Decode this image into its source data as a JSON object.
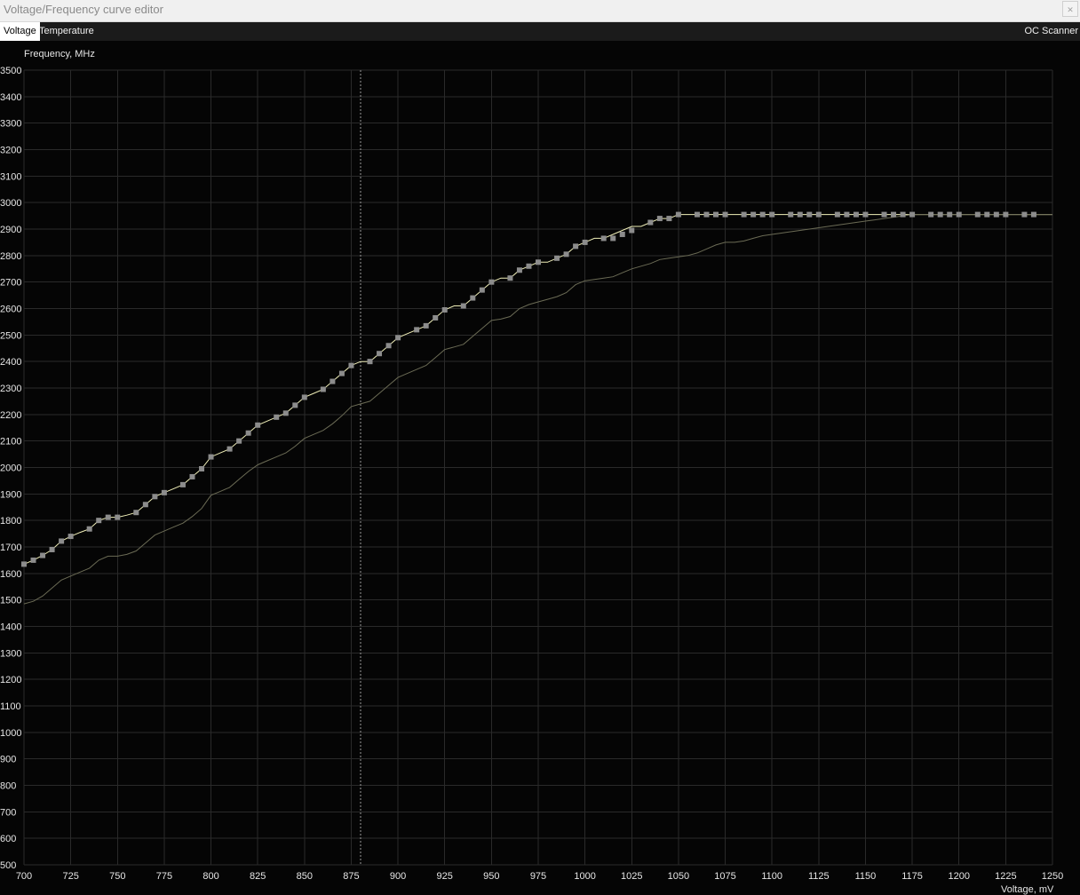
{
  "window": {
    "title": "Voltage/Frequency curve editor",
    "close_icon": "close-icon"
  },
  "tabs": [
    {
      "label": "Voltage",
      "active": true
    },
    {
      "label": "Temperature",
      "active": false
    }
  ],
  "toolbar": {
    "oc_scanner_label": "OC Scanner"
  },
  "colors": {
    "background": "#050505",
    "grid": "#2a2a2a",
    "curve": "#f0efb8",
    "point": "#8c8c8c",
    "baseline": "#6b6b55",
    "cursor": "#9a9a9a"
  },
  "chart_data": {
    "type": "line",
    "ylabel": "Frequency, MHz",
    "xlabel": "Voltage, mV",
    "xlim": [
      700,
      1250
    ],
    "ylim": [
      500,
      3500
    ],
    "x_ticks": [
      700,
      725,
      750,
      775,
      800,
      825,
      850,
      875,
      900,
      925,
      950,
      975,
      1000,
      1025,
      1050,
      1075,
      1100,
      1125,
      1150,
      1175,
      1200,
      1225,
      1250
    ],
    "y_ticks": [
      500,
      600,
      700,
      800,
      900,
      1000,
      1100,
      1200,
      1300,
      1400,
      1500,
      1600,
      1700,
      1800,
      1900,
      2000,
      2100,
      2200,
      2300,
      2400,
      2500,
      2600,
      2700,
      2800,
      2900,
      3000,
      3100,
      3200,
      3300,
      3400,
      3500
    ],
    "grid": true,
    "cursor_voltage": 880,
    "series": [
      {
        "role": "curve",
        "x": [
          700,
          705,
          710,
          715,
          720,
          725,
          730,
          735,
          740,
          745,
          750,
          755,
          760,
          765,
          770,
          775,
          780,
          785,
          790,
          795,
          800,
          805,
          810,
          815,
          820,
          825,
          830,
          835,
          840,
          845,
          850,
          855,
          860,
          865,
          870,
          875,
          880,
          885,
          890,
          895,
          900,
          905,
          910,
          915,
          920,
          925,
          930,
          935,
          940,
          945,
          950,
          955,
          960,
          965,
          970,
          975,
          980,
          985,
          990,
          995,
          1000,
          1005,
          1010,
          1015,
          1020,
          1025,
          1030,
          1035,
          1040,
          1045,
          1050,
          1055,
          1060,
          1065,
          1070,
          1075,
          1080,
          1085,
          1090,
          1095,
          1100,
          1105,
          1110,
          1115,
          1120,
          1125,
          1130,
          1135,
          1140,
          1145,
          1150,
          1155,
          1160,
          1165,
          1170,
          1175,
          1180,
          1185,
          1190,
          1195,
          1200,
          1205,
          1210,
          1215,
          1220,
          1225,
          1230,
          1235,
          1240,
          1245,
          1250
        ],
        "y": [
          1635,
          1650,
          1668,
          1690,
          1722,
          1740,
          1755,
          1768,
          1800,
          1812,
          1812,
          1820,
          1830,
          1860,
          1890,
          1905,
          1920,
          1935,
          1965,
          1995,
          2040,
          2055,
          2070,
          2100,
          2130,
          2160,
          2175,
          2190,
          2205,
          2235,
          2265,
          2280,
          2295,
          2325,
          2355,
          2385,
          2400,
          2400,
          2430,
          2460,
          2490,
          2505,
          2520,
          2535,
          2565,
          2595,
          2610,
          2610,
          2640,
          2670,
          2700,
          2715,
          2715,
          2745,
          2760,
          2775,
          2775,
          2790,
          2805,
          2835,
          2850,
          2865,
          2865,
          2880,
          2895,
          2910,
          2910,
          2925,
          2940,
          2940,
          2955,
          2955,
          2955,
          2955,
          2955,
          2955,
          2955,
          2955,
          2955,
          2955,
          2955,
          2955,
          2955,
          2955,
          2955,
          2955,
          2955,
          2955,
          2955,
          2955,
          2955,
          2955,
          2955,
          2955,
          2955,
          2955,
          2955,
          2955,
          2955,
          2955,
          2955,
          2955,
          2955,
          2955,
          2955,
          2955,
          2955,
          2955,
          2955,
          2955,
          2955
        ]
      },
      {
        "role": "baseline",
        "x": [
          700,
          705,
          710,
          715,
          720,
          725,
          730,
          735,
          740,
          745,
          750,
          755,
          760,
          765,
          770,
          775,
          780,
          785,
          790,
          795,
          800,
          805,
          810,
          815,
          820,
          825,
          830,
          835,
          840,
          845,
          850,
          855,
          860,
          865,
          870,
          875,
          880,
          885,
          890,
          895,
          900,
          905,
          910,
          915,
          920,
          925,
          930,
          935,
          940,
          945,
          950,
          955,
          960,
          965,
          970,
          975,
          980,
          985,
          990,
          995,
          1000,
          1005,
          1010,
          1015,
          1020,
          1025,
          1030,
          1035,
          1040,
          1045,
          1050,
          1055,
          1060,
          1065,
          1070,
          1075,
          1080,
          1085,
          1090,
          1095,
          1100,
          1105,
          1110,
          1115,
          1120,
          1125,
          1130,
          1135,
          1140,
          1145,
          1150,
          1155,
          1160,
          1165,
          1170,
          1175,
          1180,
          1185,
          1190,
          1195,
          1200,
          1205,
          1210,
          1215,
          1220,
          1225,
          1230,
          1235,
          1240,
          1245,
          1250
        ],
        "y": [
          1485,
          1495,
          1515,
          1545,
          1575,
          1590,
          1605,
          1620,
          1650,
          1665,
          1665,
          1672,
          1685,
          1715,
          1745,
          1760,
          1775,
          1790,
          1815,
          1845,
          1895,
          1910,
          1925,
          1955,
          1985,
          2010,
          2025,
          2040,
          2055,
          2080,
          2110,
          2125,
          2140,
          2165,
          2195,
          2230,
          2240,
          2250,
          2280,
          2310,
          2340,
          2355,
          2370,
          2385,
          2415,
          2445,
          2455,
          2465,
          2495,
          2525,
          2555,
          2560,
          2570,
          2600,
          2615,
          2625,
          2635,
          2645,
          2660,
          2690,
          2705,
          2710,
          2715,
          2720,
          2735,
          2750,
          2760,
          2770,
          2785,
          2790,
          2795,
          2800,
          2810,
          2825,
          2840,
          2850,
          2850,
          2855,
          2865,
          2875,
          2880,
          2885,
          2890,
          2895,
          2900,
          2905,
          2910,
          2915,
          2920,
          2925,
          2930,
          2935,
          2940,
          2945,
          2950,
          2955,
          2955,
          2955,
          2955,
          2955,
          2955,
          2955,
          2955,
          2955,
          2955,
          2955,
          2955,
          2955,
          2955,
          2955,
          2955
        ]
      }
    ],
    "points": {
      "x": [
        700,
        705,
        710,
        715,
        720,
        725,
        735,
        740,
        745,
        750,
        760,
        765,
        770,
        775,
        785,
        790,
        795,
        800,
        810,
        815,
        820,
        825,
        835,
        840,
        845,
        850,
        860,
        865,
        870,
        875,
        885,
        890,
        895,
        900,
        910,
        915,
        920,
        925,
        935,
        940,
        945,
        950,
        960,
        965,
        970,
        975,
        985,
        990,
        995,
        1000,
        1010,
        1015,
        1020,
        1025,
        1035,
        1040,
        1045,
        1050,
        1060,
        1065,
        1070,
        1075,
        1085,
        1090,
        1095,
        1100,
        1110,
        1115,
        1120,
        1125,
        1135,
        1140,
        1145,
        1150,
        1160,
        1165,
        1170,
        1175,
        1185,
        1190,
        1195,
        1200,
        1210,
        1215,
        1220,
        1225,
        1235,
        1240
      ],
      "y": [
        1635,
        1650,
        1668,
        1690,
        1722,
        1740,
        1768,
        1800,
        1812,
        1812,
        1830,
        1860,
        1890,
        1905,
        1935,
        1965,
        1995,
        2040,
        2070,
        2100,
        2130,
        2160,
        2190,
        2205,
        2235,
        2265,
        2295,
        2325,
        2355,
        2385,
        2400,
        2430,
        2460,
        2490,
        2520,
        2535,
        2565,
        2595,
        2610,
        2640,
        2670,
        2700,
        2715,
        2745,
        2760,
        2775,
        2790,
        2805,
        2835,
        2850,
        2865,
        2865,
        2880,
        2895,
        2925,
        2940,
        2940,
        2955,
        2955,
        2955,
        2955,
        2955,
        2955,
        2955,
        2955,
        2955,
        2955,
        2955,
        2955,
        2955,
        2955,
        2955,
        2955,
        2955,
        2955,
        2955,
        2955,
        2955,
        2955,
        2955,
        2955,
        2955,
        2955,
        2955,
        2955,
        2955,
        2955,
        2955
      ]
    }
  }
}
